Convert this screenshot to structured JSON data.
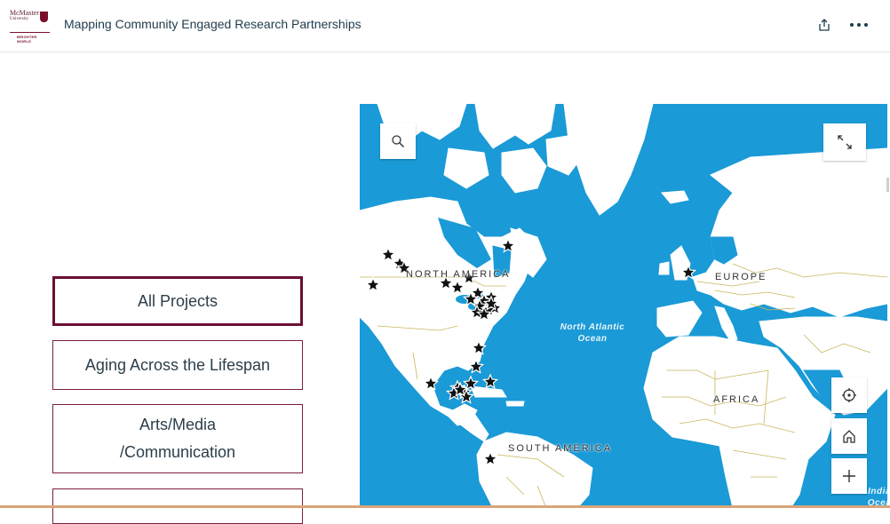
{
  "header": {
    "logo": {
      "line1": "McMaster",
      "line2": "University",
      "tagline": "BRIGHTER WORLD"
    },
    "title": "Mapping Community Engaged Research Partnerships",
    "share_icon": "share-icon",
    "more_icon": "more-horizontal-icon"
  },
  "sidebar": {
    "items": [
      {
        "label": "All Projects",
        "active": true
      },
      {
        "label": "Aging Across the Lifespan",
        "active": false
      },
      {
        "label": "Arts/Media /Communication",
        "active": false
      },
      {
        "label": "",
        "active": false
      }
    ]
  },
  "map": {
    "labels": {
      "north_america": "NORTH AMERICA",
      "europe": "EUROPE",
      "africa": "AFRICA",
      "south_america": "SOUTH AMERICA",
      "north_atlantic": "North Atlantic Ocean",
      "partial_ocean": "India Ocea"
    },
    "controls": {
      "search_icon": "search-icon",
      "expand_icon": "expand-icon",
      "locate_icon": "locate-icon",
      "home_icon": "home-icon",
      "zoom_in_icon": "plus-icon"
    },
    "colors": {
      "ocean": "#1a9ad6",
      "land": "#ffffff",
      "border": "#c9b65c",
      "marker": "#111111",
      "accent": "#7a1f3d"
    },
    "marker_count": 30
  }
}
